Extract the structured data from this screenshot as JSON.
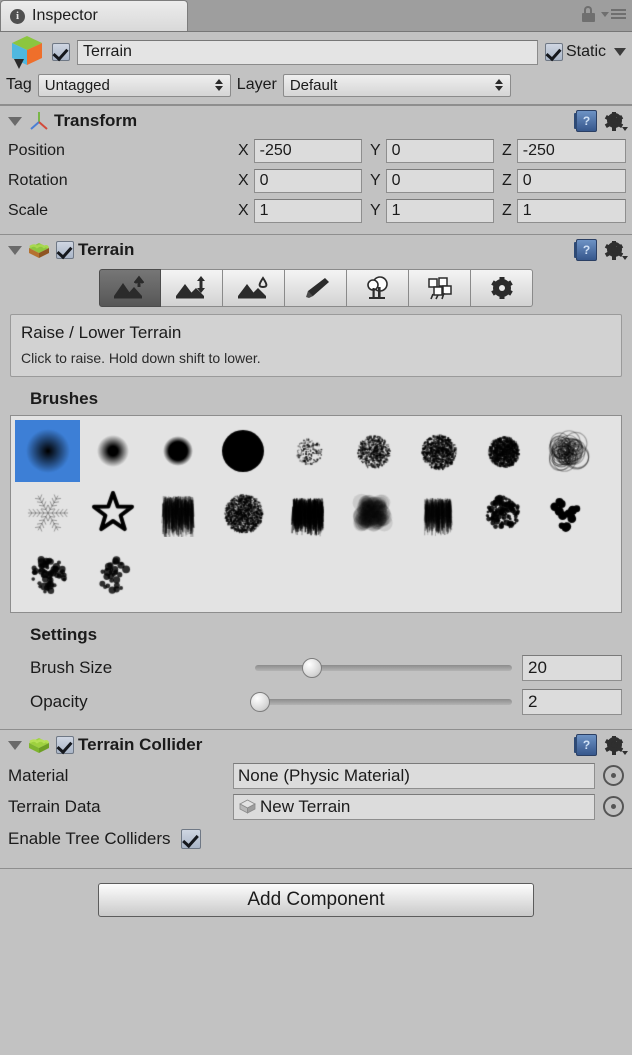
{
  "window": {
    "tab_label": "Inspector",
    "info_icon": "info-icon",
    "lock_icon": "lock-icon",
    "menu_icon": "hamburger-menu-icon"
  },
  "object_header": {
    "icon": "gameobject-cube-icon",
    "enabled": true,
    "name": "Terrain",
    "static_label": "Static",
    "static_checked": true,
    "tag_label": "Tag",
    "tag_value": "Untagged",
    "layer_label": "Layer",
    "layer_value": "Default"
  },
  "transform": {
    "title": "Transform",
    "icon": "transform-axis-icon",
    "help_icon": "help-book-icon",
    "gear_icon": "gear-icon",
    "rows": [
      {
        "label": "Position",
        "x": "-250",
        "y": "0",
        "z": "-250"
      },
      {
        "label": "Rotation",
        "x": "0",
        "y": "0",
        "z": "0"
      },
      {
        "label": "Scale",
        "x": "1",
        "y": "1",
        "z": "1"
      }
    ],
    "axis_labels": [
      "X",
      "Y",
      "Z"
    ]
  },
  "terrain": {
    "title": "Terrain",
    "icon": "terrain-icon",
    "enabled": true,
    "help_icon": "help-book-icon",
    "gear_icon": "gear-icon",
    "tools": [
      {
        "name": "raise-lower-terrain-tool",
        "active": true
      },
      {
        "name": "set-height-tool",
        "active": false
      },
      {
        "name": "smooth-height-tool",
        "active": false
      },
      {
        "name": "paint-texture-tool",
        "active": false
      },
      {
        "name": "place-trees-tool",
        "active": false
      },
      {
        "name": "paint-details-tool",
        "active": false
      },
      {
        "name": "terrain-settings-tool",
        "active": false
      }
    ],
    "description_title": "Raise / Lower Terrain",
    "description_text": "Click to raise. Hold down shift to lower.",
    "brushes_label": "Brushes",
    "brush_count": 20,
    "selected_brush_index": 0,
    "settings_label": "Settings",
    "settings": [
      {
        "label": "Brush Size",
        "value": "20",
        "percent": 22
      },
      {
        "label": "Opacity",
        "value": "2",
        "percent": 2
      }
    ]
  },
  "terrain_collider": {
    "title": "Terrain Collider",
    "icon": "terrain-icon",
    "enabled": true,
    "help_icon": "help-book-icon",
    "gear_icon": "gear-icon",
    "material_label": "Material",
    "material_value": "None (Physic Material)",
    "terrain_data_label": "Terrain Data",
    "terrain_data_value": "New Terrain",
    "terrain_data_icon": "asset-box-icon",
    "enable_tree_colliders_label": "Enable Tree Colliders",
    "enable_tree_colliders_checked": true,
    "selector_icon": "object-picker-icon"
  },
  "footer": {
    "add_component_label": "Add Component"
  },
  "colors": {
    "background": "#c2c2c2",
    "selection_blue": "#3d7fd6",
    "field": "#dcdcdc",
    "panel_border": "#8e8e8e",
    "checkbox_blue": "#aab6c8"
  }
}
